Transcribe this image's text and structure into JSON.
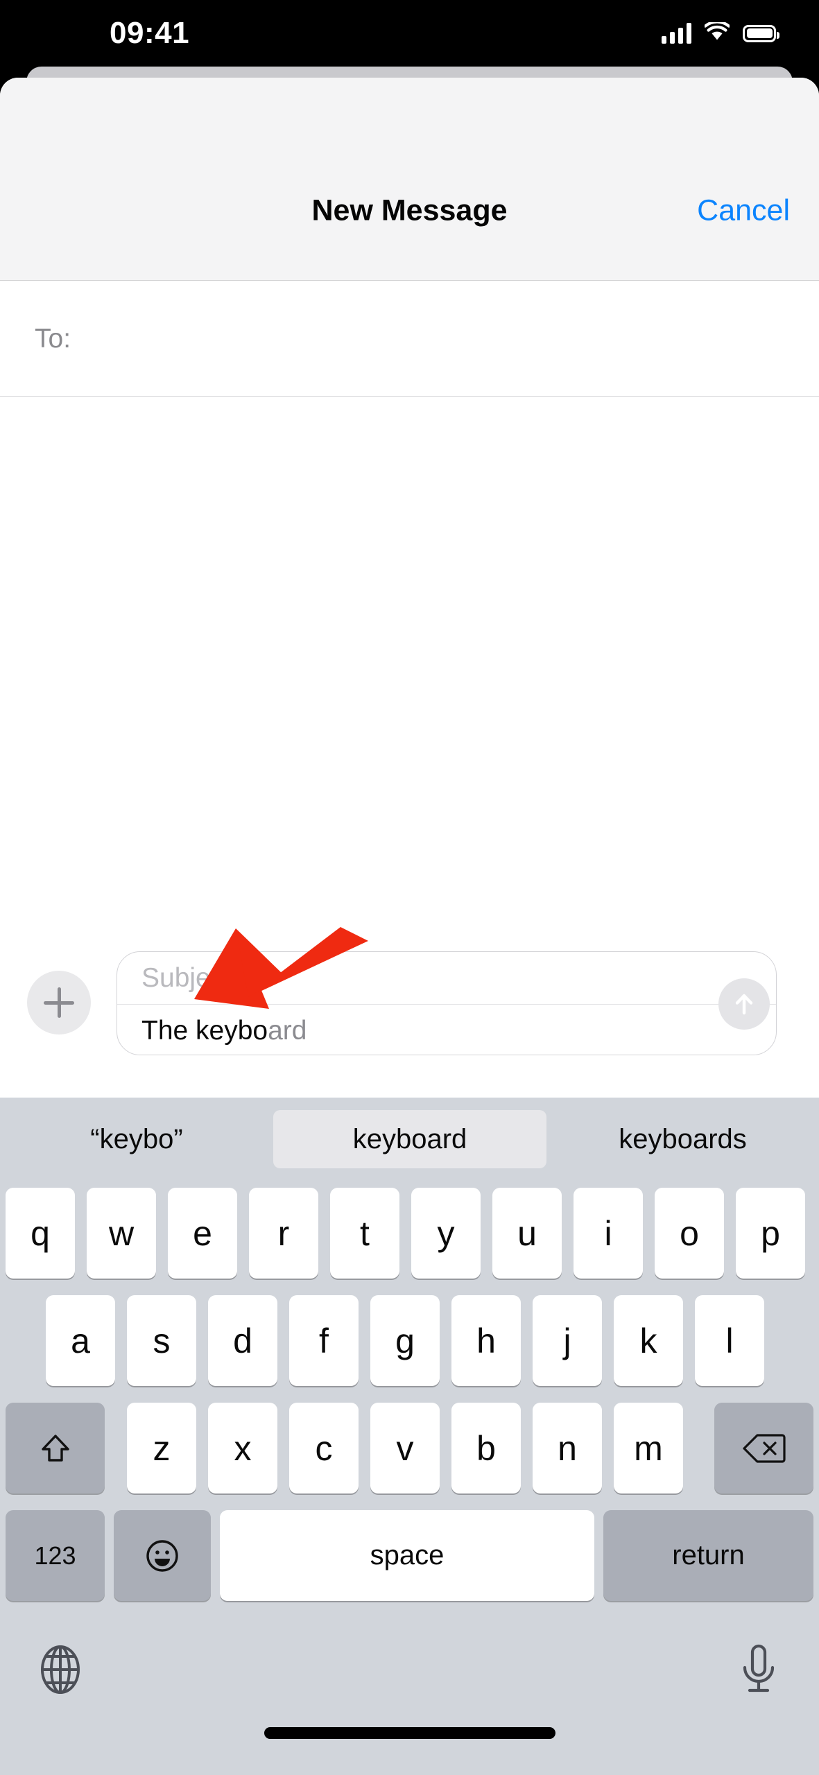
{
  "status_bar": {
    "time": "09:41",
    "cellular_icon": "signal-bars-icon",
    "wifi_icon": "wifi-icon",
    "battery_icon": "battery-icon"
  },
  "nav": {
    "title": "New Message",
    "cancel_label": "Cancel",
    "accent_color": "#0b84fe"
  },
  "recipients": {
    "label": "To:",
    "value": ""
  },
  "compose": {
    "add_button_icon": "plus-icon",
    "subject_placeholder": "Subject",
    "subject_value": "",
    "message_typed": "The keybo",
    "message_prediction": "ard",
    "send_button_icon": "arrow-up-icon"
  },
  "annotation": {
    "arrow_icon": "pointer-arrow-icon",
    "color": "#ef2a11"
  },
  "keyboard": {
    "predictions": [
      "“keybo”",
      "keyboard",
      "keyboards"
    ],
    "selected_prediction_index": 1,
    "row1": [
      "q",
      "w",
      "e",
      "r",
      "t",
      "y",
      "u",
      "i",
      "o",
      "p"
    ],
    "row2": [
      "a",
      "s",
      "d",
      "f",
      "g",
      "h",
      "j",
      "k",
      "l"
    ],
    "row3": [
      "z",
      "x",
      "c",
      "v",
      "b",
      "n",
      "m"
    ],
    "shift_icon": "shift-arrow-icon",
    "backspace_icon": "backspace-icon",
    "numbers_label": "123",
    "emoji_icon": "smiley-icon",
    "space_label": "space",
    "return_label": "return",
    "globe_icon": "globe-icon",
    "mic_icon": "microphone-icon"
  }
}
